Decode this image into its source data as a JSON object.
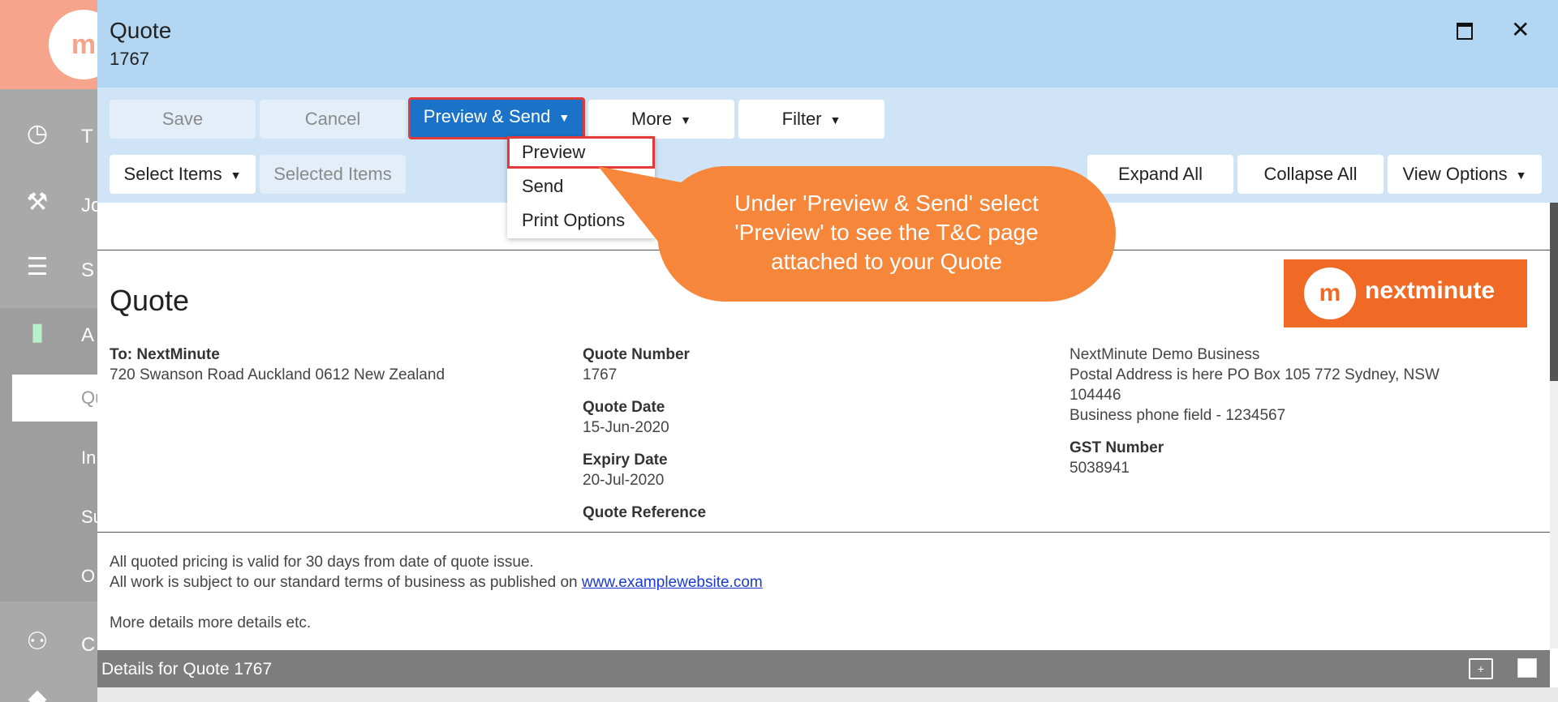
{
  "sidebar": {
    "logo_text": "m",
    "items": [
      {
        "label": "T"
      },
      {
        "label": "Jo"
      },
      {
        "label": "S"
      },
      {
        "label": "A"
      },
      {
        "label": "C"
      }
    ],
    "subitems": [
      {
        "label": "Qu"
      },
      {
        "label": "In"
      },
      {
        "label": "Su"
      },
      {
        "label": "O"
      }
    ]
  },
  "modal": {
    "title": "Quote",
    "subtitle": "1767",
    "maximize_icon": "maximize-icon",
    "close_label": "✕"
  },
  "toolbar": {
    "save_label": "Save",
    "cancel_label": "Cancel",
    "preview_send_label": "Preview & Send",
    "more_label": "More",
    "filter_label": "Filter",
    "select_items_label": "Select Items",
    "selected_items_label": "Selected Items",
    "expand_all_label": "Expand All",
    "collapse_all_label": "Collapse All",
    "view_options_label": "View Options",
    "caret": "▼"
  },
  "dropdown": {
    "items": [
      {
        "label": "Preview"
      },
      {
        "label": "Send"
      },
      {
        "label": "Print Options"
      }
    ]
  },
  "callout": {
    "text_line1": "Under 'Preview & Send' select",
    "text_line2": "'Preview' to see the T&C page",
    "text_line3": "attached to your Quote",
    "color": "#f5863a"
  },
  "document": {
    "title": "Quote",
    "to_label": "To: NextMinute",
    "to_address": "720 Swanson Road Auckland 0612 New Zealand",
    "quote_number_label": "Quote Number",
    "quote_number": "1767",
    "quote_date_label": "Quote Date",
    "quote_date": "15-Jun-2020",
    "expiry_date_label": "Expiry Date",
    "expiry_date": "20-Jul-2020",
    "quote_reference_label": "Quote Reference",
    "business_name": "NextMinute Demo Business",
    "postal_line1": "Postal Address is here PO Box 105 772 Sydney, NSW",
    "postal_line2": "104446",
    "phone": "Business phone field - 1234567",
    "gst_label": "GST Number",
    "gst_number": "5038941",
    "logo_mark": "m",
    "logo_word": "nextminute",
    "logo_color": "#f06a25",
    "terms_line1": "All quoted pricing is valid for 30 days from date of quote issue.",
    "terms_line2_prefix": "All work is subject to our standard terms of business as published on",
    "terms_link": "www.examplewebsite.com",
    "terms_line3": "More details more details etc."
  },
  "details_bar": {
    "title": "Details for Quote 1767"
  }
}
